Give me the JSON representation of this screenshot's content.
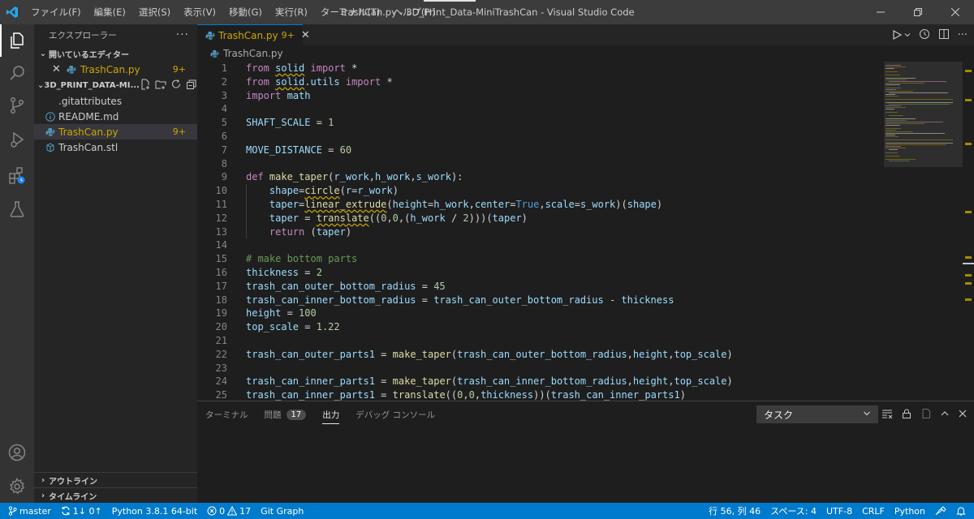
{
  "window": {
    "title": "TrashCan.py - 3D_Print_Data-MiniTrashCan - Visual Studio Code",
    "menu": [
      "ファイル(F)",
      "編集(E)",
      "選択(S)",
      "表示(V)",
      "移動(G)",
      "実行(R)",
      "ターミナル(T)",
      "ヘルプ(H)"
    ]
  },
  "sidebar": {
    "title": "エクスプローラー",
    "open_editors": {
      "header": "開いているエディター",
      "items": [
        {
          "name": "TrashCan.py",
          "badge": "9+"
        }
      ]
    },
    "workspace": {
      "header": "3D_PRINT_DATA-MI...",
      "files": [
        {
          "name": ".gitattributes",
          "badge": ""
        },
        {
          "name": "README.md",
          "badge": ""
        },
        {
          "name": "TrashCan.py",
          "badge": "9+"
        },
        {
          "name": "TrashCan.stl",
          "badge": ""
        }
      ]
    },
    "outline": "アウトライン",
    "timeline": "タイムライン"
  },
  "editor": {
    "tab": {
      "name": "TrashCan.py",
      "badge": "9+"
    },
    "breadcrumb": "TrashCan.py",
    "lines": [
      {
        "n": "1",
        "t": "from solid import *"
      },
      {
        "n": "2",
        "t": "from solid.utils import *"
      },
      {
        "n": "3",
        "t": "import math"
      },
      {
        "n": "4",
        "t": ""
      },
      {
        "n": "5",
        "t": "SHAFT_SCALE = 1"
      },
      {
        "n": "6",
        "t": ""
      },
      {
        "n": "7",
        "t": "MOVE_DISTANCE = 60"
      },
      {
        "n": "8",
        "t": ""
      },
      {
        "n": "9",
        "t": "def make_taper(r_work,h_work,s_work):"
      },
      {
        "n": "10",
        "t": "    shape=circle(r=r_work)"
      },
      {
        "n": "11",
        "t": "    taper=linear_extrude(height=h_work,center=True,scale=s_work)(shape)"
      },
      {
        "n": "12",
        "t": "    taper = translate((0,0,(h_work / 2)))(taper)"
      },
      {
        "n": "13",
        "t": "    return (taper)"
      },
      {
        "n": "14",
        "t": ""
      },
      {
        "n": "15",
        "t": "# make bottom parts"
      },
      {
        "n": "16",
        "t": "thickness = 2"
      },
      {
        "n": "17",
        "t": "trash_can_outer_bottom_radius = 45"
      },
      {
        "n": "18",
        "t": "trash_can_inner_bottom_radius = trash_can_outer_bottom_radius - thickness"
      },
      {
        "n": "19",
        "t": "height = 100"
      },
      {
        "n": "20",
        "t": "top_scale = 1.22"
      },
      {
        "n": "21",
        "t": ""
      },
      {
        "n": "22",
        "t": "trash_can_outer_parts1 = make_taper(trash_can_outer_bottom_radius,height,top_scale)"
      },
      {
        "n": "23",
        "t": ""
      },
      {
        "n": "24",
        "t": "trash_can_inner_parts1 = make_taper(trash_can_inner_bottom_radius,height,top_scale)"
      },
      {
        "n": "25",
        "t": "trash_can_inner_parts1 = translate((0,0,thickness))(trash_can_inner_parts1)"
      }
    ]
  },
  "panel": {
    "tabs": [
      "ターミナル",
      "問題",
      "出力",
      "デバッグ コンソール"
    ],
    "problems_count": "17",
    "active_tab": "出力",
    "output_select": "タスク"
  },
  "statusbar": {
    "branch": "master",
    "sync": "1↓ 0↑",
    "interpreter": "Python 3.8.1 64-bit",
    "errors": "0",
    "warnings": "17",
    "git_graph": "Git Graph",
    "position": "行 56, 列 46",
    "spaces": "スペース: 4",
    "encoding": "UTF-8",
    "eol": "CRLF",
    "language": "Python"
  },
  "colors": {
    "accent": "#007acc",
    "modified": "#cca700"
  }
}
